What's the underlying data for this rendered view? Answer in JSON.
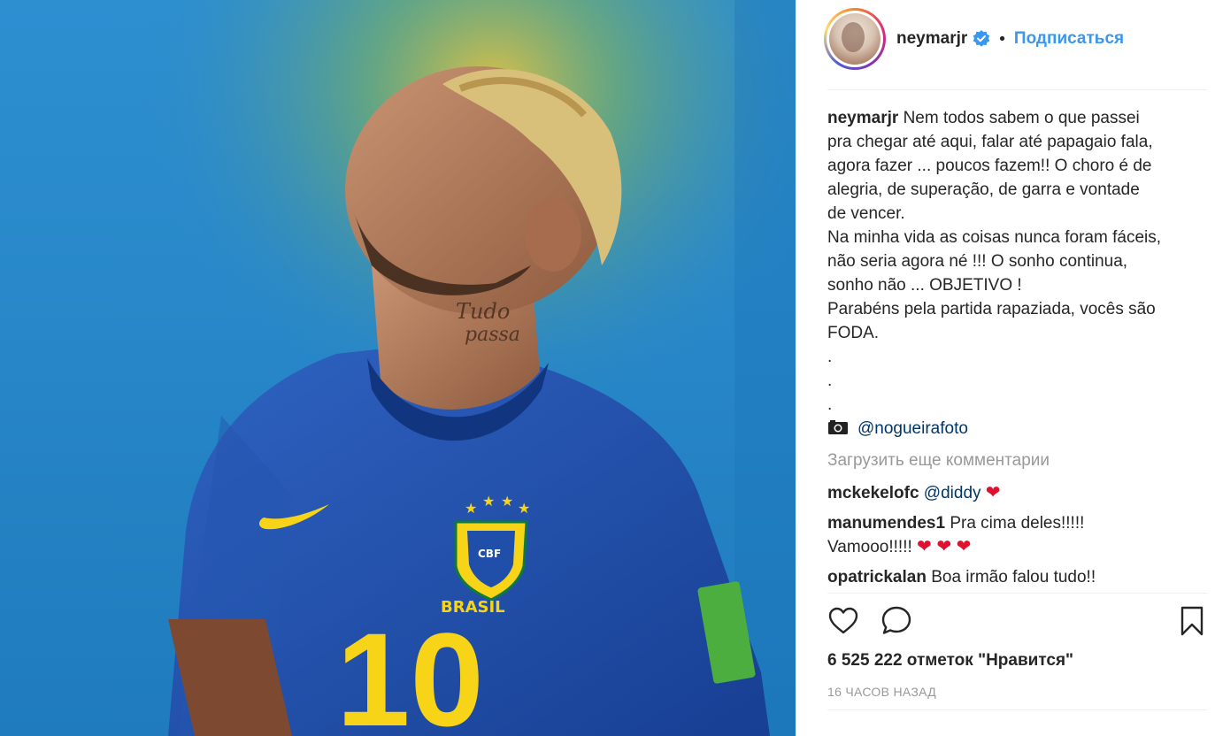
{
  "post": {
    "username": "neymarjr",
    "follow_label": "Подписаться",
    "separator": "•"
  },
  "caption": {
    "username": "neymarjr",
    "lines": [
      "Nem todos sabem o que passei",
      "pra chegar até aqui, falar até papagaio fala,",
      "agora fazer ... poucos fazem!! O choro é de",
      "alegria, de superação, de garra e vontade",
      "de vencer.",
      "Na minha vida as coisas nunca foram fáceis,",
      "não seria agora né !!! O sonho continua,",
      "sonho não ... OBJETIVO !",
      "Parabéns pela partida rapaziada, vocês são",
      "FODA.",
      ".",
      ".",
      "."
    ],
    "photo_credit": "@nogueirafoto"
  },
  "load_more_label": "Загрузить еще комментарии",
  "comments": [
    {
      "username": "mckekelofc",
      "text": "@diddy",
      "emoji": "❤"
    },
    {
      "username": "manumendes1",
      "text": "Pra cima deles!!!!!",
      "text2": "Vamooo!!!!!",
      "emoji": "❤ ❤ ❤"
    },
    {
      "username": "opatrickalan",
      "text": "Boa irmão falou tudo!!"
    }
  ],
  "likes_label": "6 525 222 отметок \"Нравится\"",
  "timestamp": "16 ЧАСОВ НАЗАД",
  "photo": {
    "jersey_number": "10",
    "jersey_text": "BRASIL",
    "crest_text": "CBF"
  },
  "icons": {
    "like": "heart-outline-icon",
    "comment": "speech-bubble-icon",
    "save": "bookmark-icon",
    "verified": "verified-badge-icon",
    "camera": "camera-icon"
  },
  "colors": {
    "link_blue": "#3897f0",
    "verified_blue": "#3897f0",
    "jersey_blue": "#1f4fa8",
    "jersey_yellow": "#f7d417"
  }
}
